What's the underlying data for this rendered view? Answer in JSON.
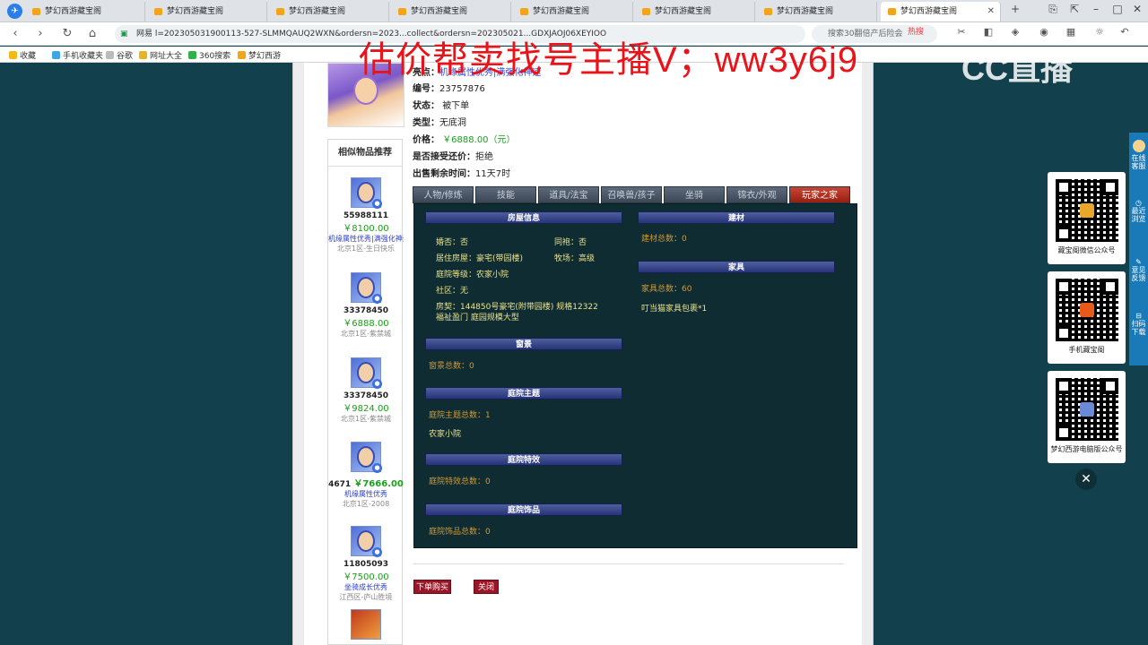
{
  "browser": {
    "tabs": [
      {
        "label": "梦幻西游藏宝阁"
      },
      {
        "label": "梦幻西游藏宝阁"
      },
      {
        "label": "梦幻西游藏宝阁"
      },
      {
        "label": "梦幻西游藏宝阁"
      },
      {
        "label": "梦幻西游藏宝阁"
      },
      {
        "label": "梦幻西游藏宝阁"
      },
      {
        "label": "梦幻西游藏宝阁"
      },
      {
        "label": "梦幻西游藏宝阁"
      }
    ],
    "url": "l=202305031900113-527-SLMMQAUQ2WXN&ordersn=2023...collect&ordersn=202305021...GDXJAOJ06XEYIOO",
    "url_prefix": "网易",
    "search_placeholder": "搜索30翻倍产后险会",
    "hot_label": "热搜",
    "bookmarks": [
      "收藏",
      "手机收藏夹",
      "谷歌",
      "网址大全",
      "360搜索",
      "梦幻西游"
    ]
  },
  "overlay": {
    "watermark": "估价帮卖找号主播V；ww3y6j9",
    "cc_logo": "CC直播"
  },
  "item": {
    "highlight_label": "亮点：",
    "highlight_value": "机缘属性优秀|满强化神速",
    "id_label": "编号：",
    "id_value": "23757876",
    "status_label": "状态：",
    "status_value": "被下单",
    "type_label": "类型：",
    "type_value": "无底洞",
    "price_label": "价格：",
    "price_value": "￥6888.00（元）",
    "bargain_label": "是否接受还价：",
    "bargain_value": "拒绝",
    "time_label": "出售剩余时间：",
    "time_value": "11天7时"
  },
  "similar": {
    "title": "相似物品推荐",
    "items": [
      {
        "id": "55988111",
        "price": "￥8100.00",
        "tag": "机缘属性优秀|满强化神速",
        "server": "北京1区-生日快乐"
      },
      {
        "id": "33378450",
        "price": "￥6888.00",
        "tag": "",
        "server": "北京1区-紫禁城"
      },
      {
        "id": "33378450",
        "price": "￥9824.00",
        "tag": "",
        "server": "北京1区-紫禁城"
      },
      {
        "id": "4671",
        "price": "￥7666.00",
        "tag": "机缘属性优秀",
        "server": "北京1区-2008"
      },
      {
        "id": "11805093",
        "price": "￥7500.00",
        "tag": "坐骑成长优秀",
        "server": "江西区-庐山胜境"
      }
    ]
  },
  "tabs": [
    "人物/修炼",
    "技能",
    "道具/法宝",
    "召唤兽/孩子",
    "坐骑",
    "锦衣/外观",
    "玩家之家"
  ],
  "active_tab": "玩家之家",
  "house": {
    "section_title": "房屋信息",
    "married": "婚否：否",
    "cohabit": "同袍：否",
    "house_type": "居住房屋：豪宅(带园楼)",
    "ranch": "牧场：高级",
    "yard_level": "庭院等级：农家小院",
    "community": "社区：无",
    "deed": "房契：144850号豪宅(附带园楼) 规格12322",
    "deed2": "福祉盈门 庭园规模大型",
    "scenery_title": "窗景",
    "scenery_count": "窗景总数：0",
    "theme_title": "庭院主题",
    "theme_count": "庭院主题总数：1",
    "theme_item": "农家小院",
    "effect_title": "庭院特效",
    "effect_count": "庭院特效总数：0",
    "deco_title": "庭院饰品",
    "deco_count": "庭院饰品总数：0",
    "material_title": "建材",
    "material_count": "建材总数：0",
    "furniture_title": "家具",
    "furniture_count": "家具总数：60",
    "furniture_item": "叮当猫家具包裹*1"
  },
  "actions": {
    "buy": "下单购买",
    "close": "关闭"
  },
  "sidebar_right": {
    "qr_captions": [
      "藏宝阁微信公众号",
      "手机藏宝阁",
      "梦幻西游电脑版公众号"
    ],
    "edge_items": [
      "在线客服",
      "最近浏览",
      "意见反馈",
      "扫码下载"
    ]
  }
}
